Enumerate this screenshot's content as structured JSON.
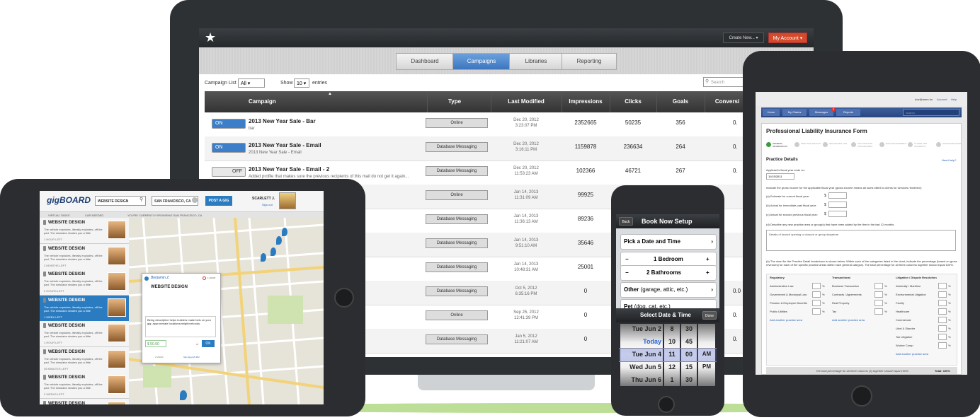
{
  "desktop": {
    "create_new": "Create New... ▾",
    "my_account": "My Account ▾",
    "tabs": [
      "Dashboard",
      "Campaigns",
      "Libraries",
      "Reporting"
    ],
    "campaign_list_label": "Campaign List",
    "campaign_list_value": "All",
    "show_label": "Show",
    "show_value": "10",
    "entries_label": "entries",
    "search_placeholder": "Search",
    "columns": [
      "Campaign",
      "Type",
      "Last Modified",
      "Impressions",
      "Clicks",
      "Goals",
      "Conversi"
    ],
    "rows": [
      {
        "toggle": "ON",
        "name": "2013 New Year Sale - Bar",
        "sub": "bar",
        "type": "Online",
        "date": "Dec 20, 2012",
        "time": "3:23:07 PM",
        "impressions": "2352665",
        "clicks": "50235",
        "goals": "356",
        "conv": "0."
      },
      {
        "toggle": "ON",
        "name": "2013 New Year Sale - Email",
        "sub": "2013 New Year Sale - Email",
        "type": "Database Messaging",
        "date": "Dec 20, 2012",
        "time": "3:16:11 PM",
        "impressions": "1159878",
        "clicks": "236634",
        "goals": "264",
        "conv": "0."
      },
      {
        "toggle": "OFF",
        "name": "2013 New Year Sale - Email - 2",
        "sub": "Added profile that makes sure the previous recipients of this mail do not get it again...",
        "type": "Database Messaging",
        "date": "Dec 20, 2012",
        "time": "11:53:23 AM",
        "impressions": "102366",
        "clicks": "46721",
        "goals": "267",
        "conv": "0."
      },
      {
        "toggle": "",
        "name": "",
        "sub": "",
        "type": "Online",
        "date": "Jan 14, 2013",
        "time": "11:31:09 AM",
        "impressions": "99925",
        "clicks": "",
        "goals": "",
        "conv": ""
      },
      {
        "toggle": "",
        "name": "",
        "sub": "",
        "type": "Database Messaging",
        "date": "Jan 14, 2013",
        "time": "11:36:13 AM",
        "impressions": "89236",
        "clicks": "",
        "goals": "",
        "conv": ""
      },
      {
        "toggle": "",
        "name": "",
        "sub": "",
        "type": "Database Messaging",
        "date": "Jan 14, 2013",
        "time": "9:51:10 AM",
        "impressions": "35646",
        "clicks": "",
        "goals": "",
        "conv": ""
      },
      {
        "toggle": "",
        "name": "",
        "sub": "",
        "type": "Database Messaging",
        "date": "Jan 14, 2013",
        "time": "10:48:31 AM",
        "impressions": "25001",
        "clicks": "",
        "goals": "",
        "conv": ""
      },
      {
        "toggle": "",
        "name": "",
        "sub": "",
        "type": "Database Messaging",
        "date": "Oct 5, 2012",
        "time": "6:35:16 PM",
        "impressions": "0",
        "clicks": "",
        "goals": "",
        "conv": "0.0"
      },
      {
        "toggle": "",
        "name": "",
        "sub": "",
        "type": "Online",
        "date": "Sep 25, 2012",
        "time": "12:41:39 PM",
        "impressions": "0",
        "clicks": "",
        "goals": "",
        "conv": "0."
      },
      {
        "toggle": "",
        "name": "",
        "sub": "",
        "type": "Database Messaging",
        "date": "Jan 5, 2012",
        "time": "11:21:07 AM",
        "impressions": "0",
        "clicks": "",
        "goals": "",
        "conv": "0."
      }
    ]
  },
  "gigboard": {
    "logo": "gigBOARD",
    "search_value": "WEBSITE DESIGN",
    "location_value": "SAN FRANCISCO, CA",
    "post_button": "POST A GIG",
    "user_name": "SCARLETT J.",
    "sign_out": "Sign out",
    "filter_virtual": "VIRTUAL TASKS",
    "filter_car": "CAR NEEDED",
    "browsing_text": "YOU'RE CURRENTLY BROWSING SAN FRANCISCO, CA",
    "item_title": "WEBSITE DESIGN",
    "item_desc": "The vehicle explodes, literally explodes, off the pad. The simulator shakes you a little",
    "item_meta": [
      "1 HOUR LEFT",
      "2 MONTHS LEFT",
      "2 HOURS LEFT",
      "1 WEEK LEFT",
      "1 HOUR LEFT",
      "45 MINUTES LEFT",
      "2 WEEKS LEFT",
      "1 HOUR LEFT"
    ],
    "popup_user": "Benjamin Z.",
    "popup_badge": "1 HOUR",
    "popup_title": "WEBSITE DESIGN",
    "popup_desc": "Being descriptive helps builders make bids on your gig: approximate locations/neighborhoods.",
    "popup_price": "50.00",
    "popup_or": "or",
    "popup_ok": "OK",
    "popup_url": "http://gig.ly/b.#h2",
    "popup_dist": "2 MILES"
  },
  "phone": {
    "back": "Back",
    "title": "Book Now Setup",
    "pick": "Pick a Date and Time",
    "bed_minus": "−",
    "bedrooms": "1 Bedroom",
    "bed_plus": "+",
    "bath_minus": "−",
    "bathrooms": "2 Bathrooms",
    "bath_plus": "+",
    "other": "Other",
    "other_sub": "(garage, attic, etc.)",
    "pet": "Pet",
    "pet_sub": "(dog, cat, etc.)",
    "picker_title": "Select Date & Time",
    "done": "Done",
    "days": [
      "Tue Jun 2",
      "Today",
      "Tue Jun 4",
      "Wed Jun 5",
      "Thu Jun 6"
    ],
    "hours": [
      "8",
      "10",
      "11",
      "12",
      "1"
    ],
    "mins": [
      "30",
      "45",
      "00",
      "15",
      "30"
    ],
    "ampm": [
      "",
      "",
      "AM",
      "PM",
      ""
    ]
  },
  "form": {
    "email": "doe@amm.lm",
    "account": "Account",
    "help": "Help",
    "nav": [
      "Home",
      "My Claims",
      "Messages",
      "Reports"
    ],
    "nav_badge": "2",
    "search_placeholder": "Search",
    "title": "Professional Liability Insurance Form",
    "steps": [
      "GENERAL INFORMATION",
      "PRACTICE DETAILS",
      "SECURITIES LAW",
      "POLICIES AND PROCEDURES",
      "RISK MANAGEMENT",
      "CLAIMS AND INCIDENTS",
      "SIGNATURE PAGE"
    ],
    "section": "Practice Details",
    "need_help": "Need help?",
    "fiscal_label": "Applicant's fiscal year ends on:",
    "fiscal_value": "11/15/2011",
    "gross_label": "Indicate the gross income for the applicable fiscal year (gross income means all sums billed to clients for services rendered):",
    "est_current": "(a) Estimate for current fiscal year:",
    "actual_prev": "(b) Actual for immediate past fiscal year:",
    "actual_second": "(c) Actual for second previous fiscal year:",
    "currency": "$",
    "describe_label": "(d) Describe any new practice area or group(s) that have been added by the firm in the last 12 months",
    "describe_value": "Details of branch opening or closure or group departure",
    "chart_label": "(b) The chart for the Practice Detail breakdown is shown below. Within each of the categories listed in the chart, indicate the percentage (based on gross revenues) for each of the specific practice areas within each general category. The total percentage for all three columns together should equal 100%.",
    "cols": [
      "Regulatory",
      "Transactional",
      "Litigation / Dispute Resolution"
    ],
    "col1": [
      "Administrative Law",
      "Government & Municipal Law",
      "Pension & Employee Benefits",
      "Public Utilities"
    ],
    "col2": [
      "Business Transaction",
      "Contracts / Agreements",
      "Real Property",
      "Tax"
    ],
    "col3": [
      "Admiralty / Maritime",
      "Environmental Litigation",
      "Family",
      "Healthcare",
      "Commercial",
      "Libel & Slander",
      "Tax Litigation",
      "Worker Comp"
    ],
    "percent": "%",
    "add_area": "Add another practice area",
    "total_note": "The total percentage for all three columns (3) together should equal 100%",
    "total": "Total: 100%"
  }
}
